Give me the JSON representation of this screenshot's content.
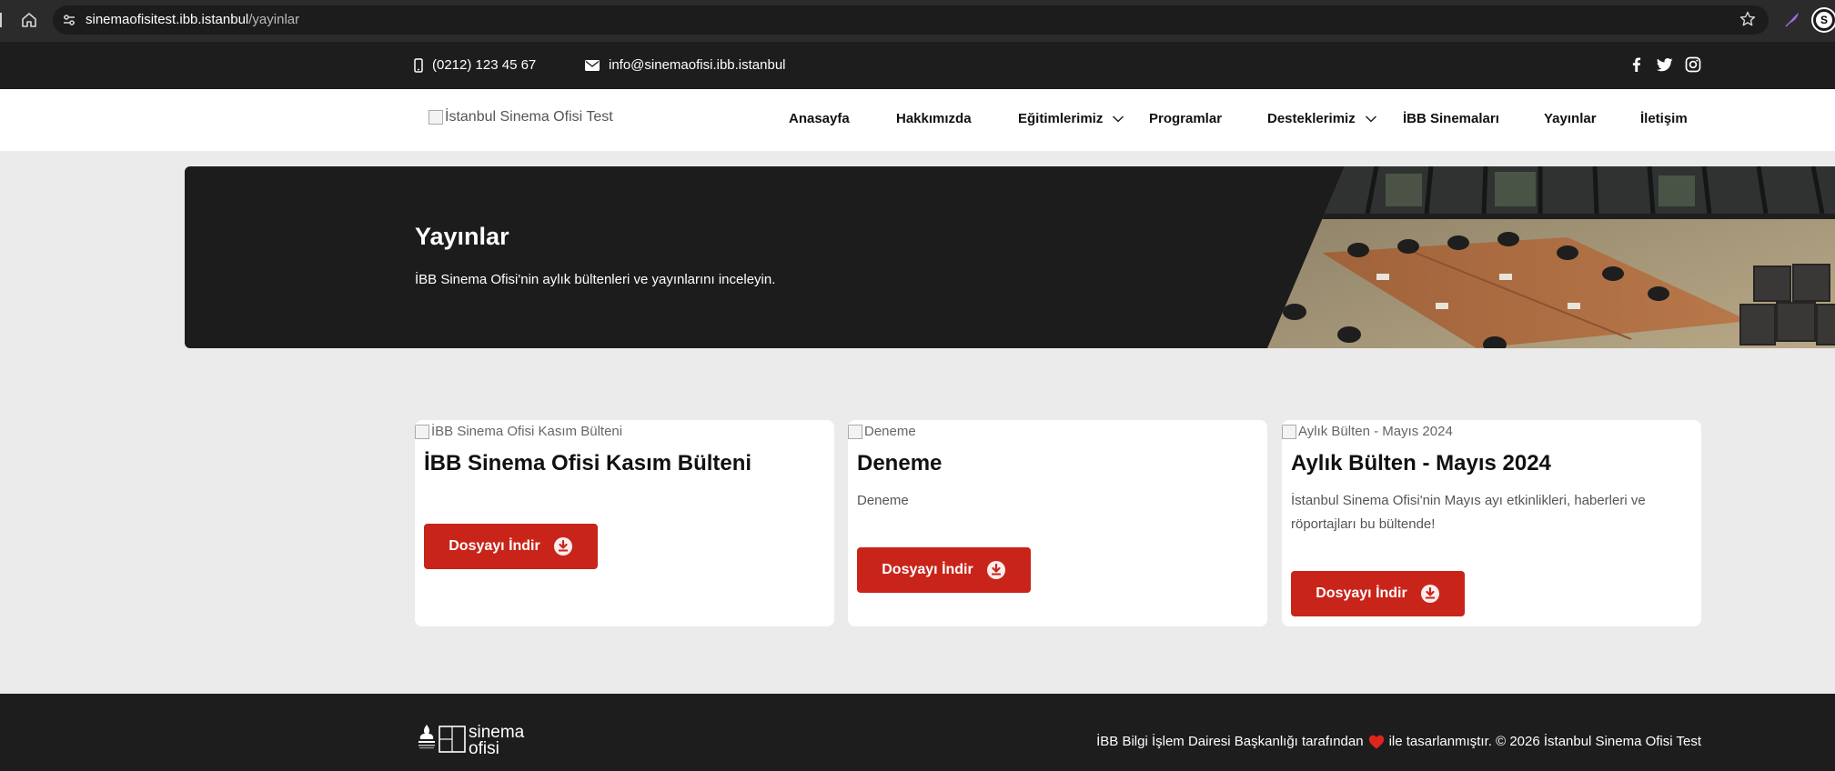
{
  "browser": {
    "url_host": "sinemaofisitest.ibb.istanbul",
    "url_path": "/yayinlar",
    "profile_initial": "S"
  },
  "topbar": {
    "phone": "(0212) 123 45 67",
    "email": "info@sinemaofisi.ibb.istanbul",
    "social_icons": [
      "facebook-icon",
      "twitter-icon",
      "instagram-icon"
    ]
  },
  "nav": {
    "logo_alt": "İstanbul Sinema Ofisi Test",
    "items": [
      {
        "label": "Anasayfa",
        "has_dropdown": false
      },
      {
        "label": "Hakkımızda",
        "has_dropdown": false
      },
      {
        "label": "Eğitimlerimiz",
        "has_dropdown": true
      },
      {
        "label": "Programlar",
        "has_dropdown": false
      },
      {
        "label": "Desteklerimiz",
        "has_dropdown": true
      },
      {
        "label": "İBB Sinemaları",
        "has_dropdown": false
      },
      {
        "label": "Yayınlar",
        "has_dropdown": false
      },
      {
        "label": "İletişim",
        "has_dropdown": false
      }
    ]
  },
  "hero": {
    "title": "Yayınlar",
    "subtitle": "İBB Sinema Ofisi'nin aylık bültenleri ve yayınlarını inceleyin."
  },
  "cards": [
    {
      "image_alt": "İBB Sinema Ofisi Kasım Bülteni",
      "title": "İBB Sinema Ofisi Kasım Bülteni",
      "description": "",
      "button_label": "Dosyayı İndir"
    },
    {
      "image_alt": "Deneme",
      "title": "Deneme",
      "description": "Deneme",
      "button_label": "Dosyayı İndir"
    },
    {
      "image_alt": "Aylık Bülten - Mayıs 2024",
      "title": "Aylık Bülten - Mayıs 2024",
      "description": "İstanbul Sinema Ofisi'nin Mayıs ayı etkinlikleri, haberleri ve röportajları bu bültende!",
      "button_label": "Dosyayı İndir"
    }
  ],
  "footer": {
    "logo_text_1": "sinema",
    "logo_text_2": "ofisi",
    "credit_before": "İBB Bilgi İşlem Dairesi Başkanlığı tarafından",
    "credit_after": "ile tasarlanmıştır. © 2026 İstanbul Sinema Ofisi Test"
  },
  "colors": {
    "accent_red": "#c9241a",
    "dark_bg": "#1d1d1d",
    "page_bg": "#ebebeb"
  }
}
